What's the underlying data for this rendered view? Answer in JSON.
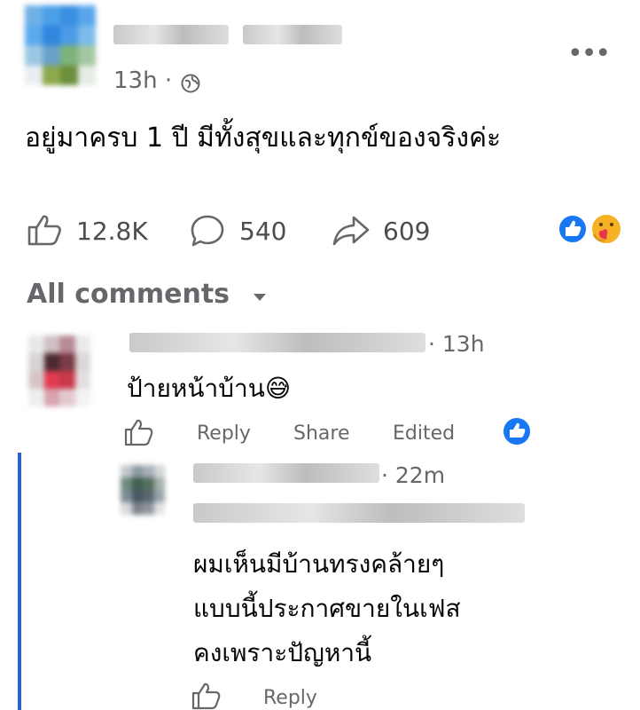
{
  "post": {
    "time": "13h",
    "time_separator": "·",
    "text": "อยู่มาครบ 1 ปี มีทั้งสุขและทุกข์ของจริงค่ะ",
    "more_label": "•••"
  },
  "stats": {
    "likes": "12.8K",
    "comments": "540",
    "shares": "609"
  },
  "comments_header": {
    "label": "All comments"
  },
  "comments": [
    {
      "time": "· 13h",
      "text": "ป้ายหน้าบ้าน😅",
      "reply_label": "Reply",
      "share_label": "Share",
      "edited_label": "Edited"
    }
  ],
  "reply": {
    "time": "· 22m",
    "lines": [
      "ผมเห็นมีบ้านทรงคล้ายๆ",
      "แบบนี้ประกาศขายในเฟส",
      "คงเพราะปัญหานี้"
    ],
    "reply_label": "Reply"
  },
  "colors": {
    "facebook_blue": "#1877f2",
    "secondary_text": "#65676b",
    "thread_line": "#2d63c8"
  },
  "icons": [
    "globe-icon",
    "more-icon",
    "like-icon",
    "comment-icon",
    "share-icon",
    "like-reaction-icon",
    "care-reaction-icon",
    "caret-down-icon"
  ]
}
